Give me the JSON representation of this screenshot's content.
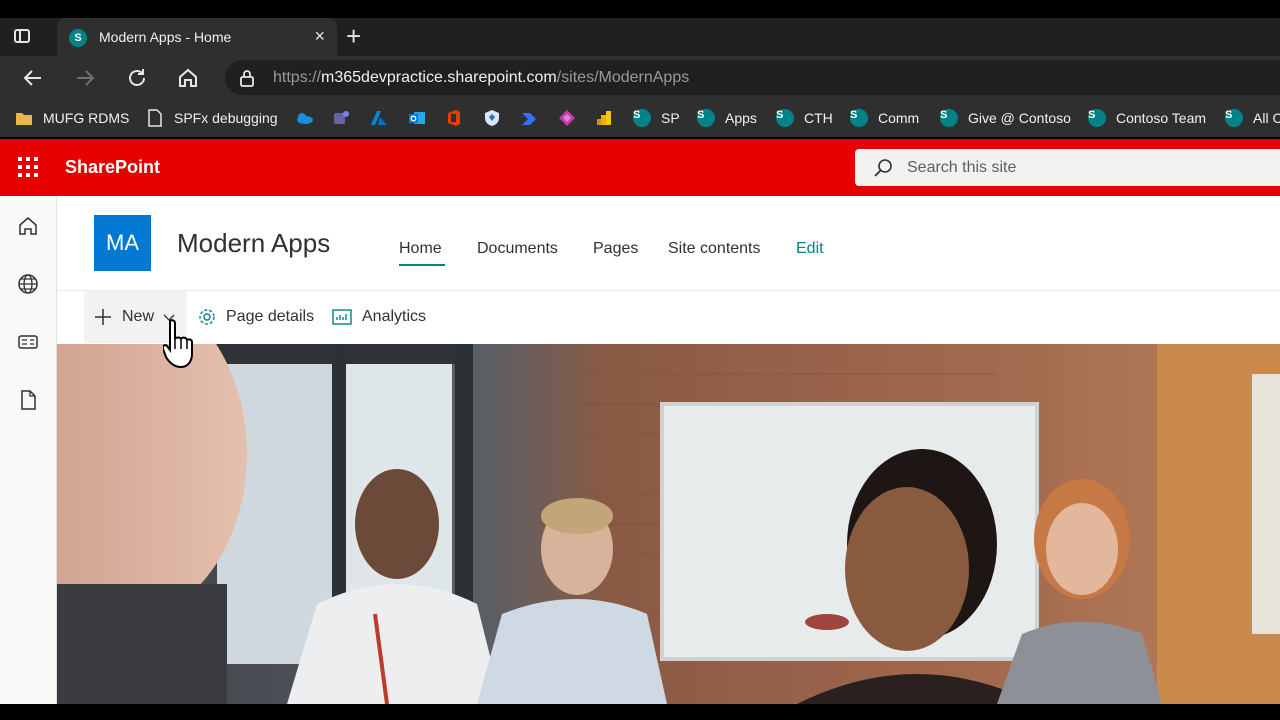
{
  "browser": {
    "tab_title": "Modern Apps - Home",
    "tab_close": "×",
    "new_tab": "+",
    "url_prefix": "https://",
    "url_host": "m365devpractice.sharepoint.com",
    "url_path": "/sites/ModernApps"
  },
  "favorites": [
    {
      "label": "MUFG RDMS",
      "icon": "folder-icon"
    },
    {
      "label": "SPFx debugging",
      "icon": "page-icon"
    },
    {
      "label": "",
      "icon": "onedrive-icon"
    },
    {
      "label": "",
      "icon": "teams-icon"
    },
    {
      "label": "",
      "icon": "azure-icon"
    },
    {
      "label": "",
      "icon": "outlook-icon"
    },
    {
      "label": "",
      "icon": "office-icon"
    },
    {
      "label": "",
      "icon": "shield-icon"
    },
    {
      "label": "",
      "icon": "automate-icon"
    },
    {
      "label": "",
      "icon": "powerapps-icon"
    },
    {
      "label": "",
      "icon": "powerbi-icon"
    },
    {
      "label": "SP",
      "icon": "sharepoint-icon"
    },
    {
      "label": "Apps",
      "icon": "sharepoint-icon"
    },
    {
      "label": "CTH",
      "icon": "sharepoint-icon"
    },
    {
      "label": "Comm",
      "icon": "sharepoint-icon"
    },
    {
      "label": "Give @ Contoso",
      "icon": "sharepoint-icon"
    },
    {
      "label": "Contoso Team",
      "icon": "sharepoint-icon"
    },
    {
      "label": "All C",
      "icon": "sharepoint-icon"
    }
  ],
  "suitebar": {
    "brand": "SharePoint",
    "search_placeholder": "Search this site",
    "color": "#e60000"
  },
  "site": {
    "logo_initials": "MA",
    "title": "Modern Apps",
    "nav": [
      {
        "label": "Home",
        "active": true
      },
      {
        "label": "Documents"
      },
      {
        "label": "Pages"
      },
      {
        "label": "Site contents"
      },
      {
        "label": "Edit"
      }
    ],
    "accent": "#038387",
    "logo_color": "#0078d4"
  },
  "commands": {
    "new": "New",
    "page_details": "Page details",
    "analytics": "Analytics"
  },
  "sp_letter": "S"
}
